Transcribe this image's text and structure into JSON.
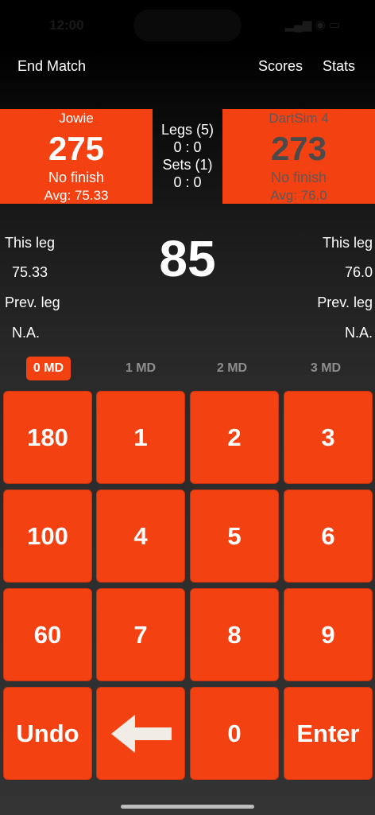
{
  "status_bar": {
    "time": "12:00",
    "icons": "▂▄▆ ◉ ▭"
  },
  "nav": {
    "end_match": "End Match",
    "scores": "Scores",
    "stats": "Stats"
  },
  "players": [
    {
      "name": "Jowie",
      "score": "275",
      "finish": "No finish",
      "avg": "Avg: 75.33"
    },
    {
      "name": "DartSim 4",
      "score": "273",
      "finish": "No finish",
      "avg": "Avg: 76.0"
    }
  ],
  "match": {
    "legs_label": "Legs (5)",
    "legs_score": "0 : 0",
    "sets_label": "Sets (1)",
    "sets_score": "0 : 0"
  },
  "stats": {
    "this_leg_label": "This leg",
    "prev_leg_label": "Prev. leg",
    "left_this_leg": "75.33",
    "left_prev_leg": "N.A.",
    "right_this_leg": "76.0",
    "right_prev_leg": "N.A."
  },
  "current_input": "85",
  "md_options": [
    "0 MD",
    "1 MD",
    "2 MD",
    "3 MD"
  ],
  "md_selected": "0 MD",
  "keys": [
    "180",
    "1",
    "2",
    "3",
    "100",
    "4",
    "5",
    "6",
    "60",
    "7",
    "8",
    "9",
    "Undo",
    "backspace-arrow",
    "0",
    "Enter"
  ],
  "colors": {
    "accent": "#f44112",
    "background": "#2a2a2a",
    "inactive_text": "#8e8e8e"
  }
}
